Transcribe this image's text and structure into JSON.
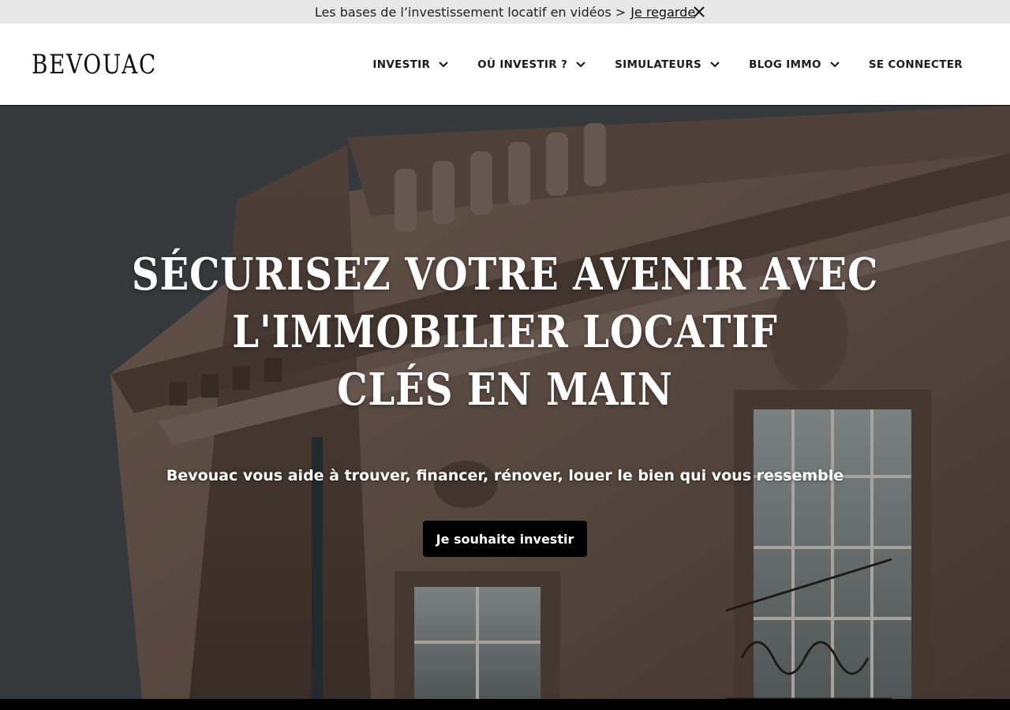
{
  "banner": {
    "message": "Les bases de l’investissement locatif en vidéos >",
    "link_label": "Je regarde",
    "close_icon": "close-icon"
  },
  "header": {
    "logo": "BEVOUAC",
    "nav": [
      {
        "label": "INVESTIR",
        "has_dropdown": true
      },
      {
        "label": "OÙ INVESTIR ?",
        "has_dropdown": true
      },
      {
        "label": "SIMULATEURS",
        "has_dropdown": true
      },
      {
        "label": "BLOG IMMO",
        "has_dropdown": true
      },
      {
        "label": "SE CONNECTER",
        "has_dropdown": false
      }
    ]
  },
  "hero": {
    "title_lines": [
      "SÉCURISEZ VOTRE AVENIR AVEC",
      "L'IMMOBILIER LOCATIF",
      "CLÉS EN MAIN"
    ],
    "subtitle": "Bevouac vous aide à trouver, financer, rénover, louer le bien qui vous ressemble",
    "cta_label": "Je souhaite investir",
    "background_image": "facade-building-photo"
  },
  "colors": {
    "banner_bg": "#e8e8e8",
    "header_bg": "#ffffff",
    "cta_bg": "#000000",
    "text_light": "#ffffff"
  }
}
